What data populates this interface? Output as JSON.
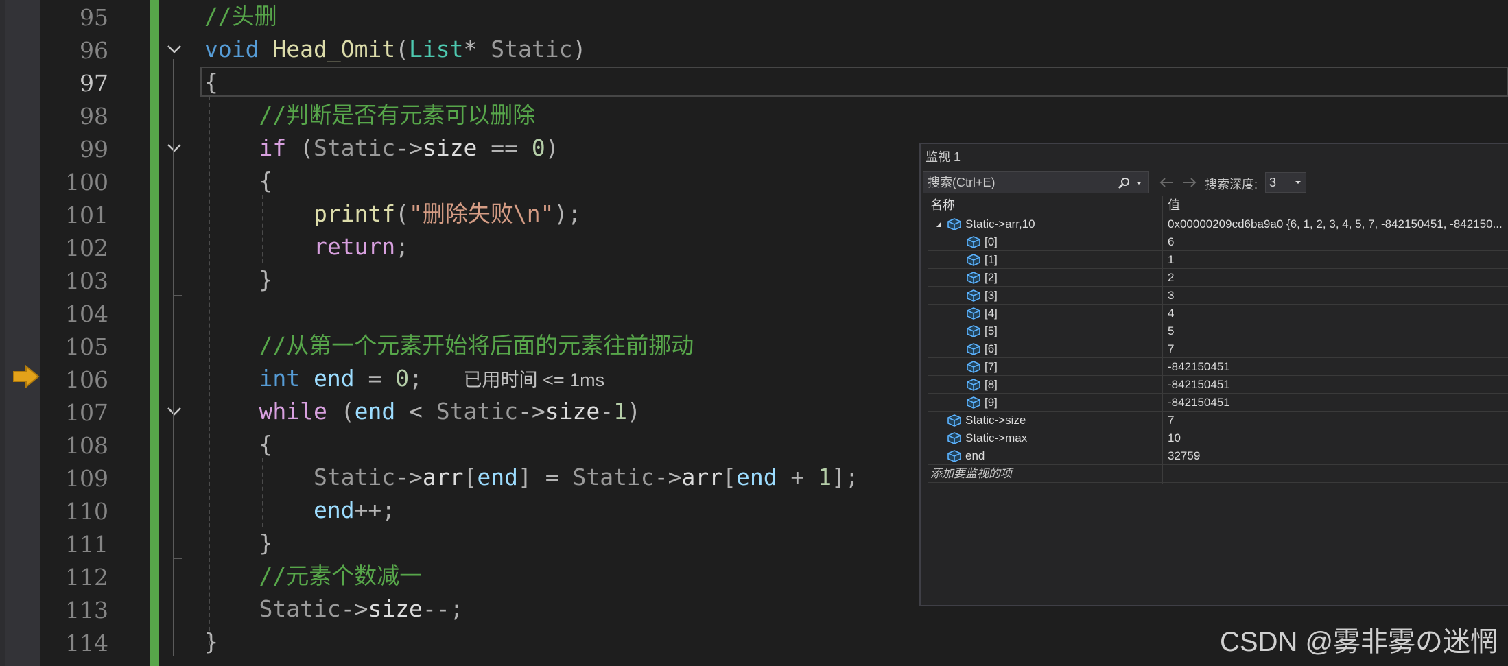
{
  "editor": {
    "line_numbers": [
      "95",
      "96",
      "97",
      "98",
      "99",
      "100",
      "101",
      "102",
      "103",
      "104",
      "105",
      "106",
      "107",
      "108",
      "109",
      "110",
      "111",
      "112",
      "113",
      "114"
    ],
    "current_line": "97",
    "exec_line": "106",
    "code": {
      "l95": {
        "comment": "//头删"
      },
      "l96": {
        "kw": "void",
        "fn": "Head_Omit",
        "p1": "(",
        "type": "List",
        "p2": "* ",
        "param": "Static",
        "p3": ")"
      },
      "l97": {
        "brace": "{"
      },
      "l98": {
        "comment": "//判断是否有元素可以删除"
      },
      "l99": {
        "kw": "if",
        "p1": " (",
        "param": "Static",
        "arrow": "->",
        "member": "size",
        "op": " == ",
        "num": "0",
        "p2": ")"
      },
      "l100": {
        "brace": "{"
      },
      "l101": {
        "fn": "printf",
        "p1": "(",
        "str": "\"删除失败\\n\"",
        "p2": ");"
      },
      "l102": {
        "kw": "return",
        "p1": ";"
      },
      "l103": {
        "brace": "}"
      },
      "l105": {
        "comment": "//从第一个元素开始将后面的元素往前挪动"
      },
      "l106": {
        "kw": "int",
        "var": "end",
        "op": " = ",
        "num": "0",
        "p1": ";",
        "elapsed": "已用时间 <= 1ms"
      },
      "l107": {
        "kw": "while",
        "p1": " (",
        "var": "end",
        "op": " < ",
        "param": "Static",
        "arrow": "->",
        "member": "size",
        "op2": "-",
        "num": "1",
        "p2": ")"
      },
      "l108": {
        "brace": "{"
      },
      "l109": {
        "param1": "Static",
        "arrow1": "->",
        "member1": "arr",
        "b1": "[",
        "var1": "end",
        "b2": "]",
        "op": " = ",
        "param2": "Static",
        "arrow2": "->",
        "member2": "arr",
        "b3": "[",
        "var2": "end",
        "op2": " + ",
        "num": "1",
        "b4": "];"
      },
      "l110": {
        "var": "end",
        "op": "++",
        "p1": ";"
      },
      "l111": {
        "brace": "}"
      },
      "l112": {
        "comment": "//元素个数减一"
      },
      "l113": {
        "param": "Static",
        "arrow": "->",
        "member": "size",
        "op": "--",
        "p1": ";"
      },
      "l114": {
        "brace": "}"
      }
    }
  },
  "watch": {
    "title": "监视 1",
    "search_placeholder": "搜索(Ctrl+E)",
    "depth_label": "搜索深度:",
    "depth_value": "3",
    "columns": {
      "name": "名称",
      "value": "值"
    },
    "rows": [
      {
        "name": "Static->arr,10",
        "value": "0x00000209cd6ba9a0 {6, 1, 2, 3, 4, 5, 7, -842150451, -842150..."
      },
      {
        "name": "[0]",
        "value": "6"
      },
      {
        "name": "[1]",
        "value": "1"
      },
      {
        "name": "[2]",
        "value": "2"
      },
      {
        "name": "[3]",
        "value": "3"
      },
      {
        "name": "[4]",
        "value": "4"
      },
      {
        "name": "[5]",
        "value": "5"
      },
      {
        "name": "[6]",
        "value": "7"
      },
      {
        "name": "[7]",
        "value": "-842150451"
      },
      {
        "name": "[8]",
        "value": "-842150451"
      },
      {
        "name": "[9]",
        "value": "-842150451"
      },
      {
        "name": "Static->size",
        "value": "7"
      },
      {
        "name": "Static->max",
        "value": "10"
      },
      {
        "name": "end",
        "value": "32759"
      }
    ],
    "add_item": "添加要监视的项"
  },
  "watermark": "CSDN @雾非雾の迷惘",
  "colors": {
    "background": "#1e1e1e",
    "change_bar": "#57a64a",
    "comment": "#57a64a",
    "keyword": "#569cd6",
    "control": "#d8a0df"
  }
}
